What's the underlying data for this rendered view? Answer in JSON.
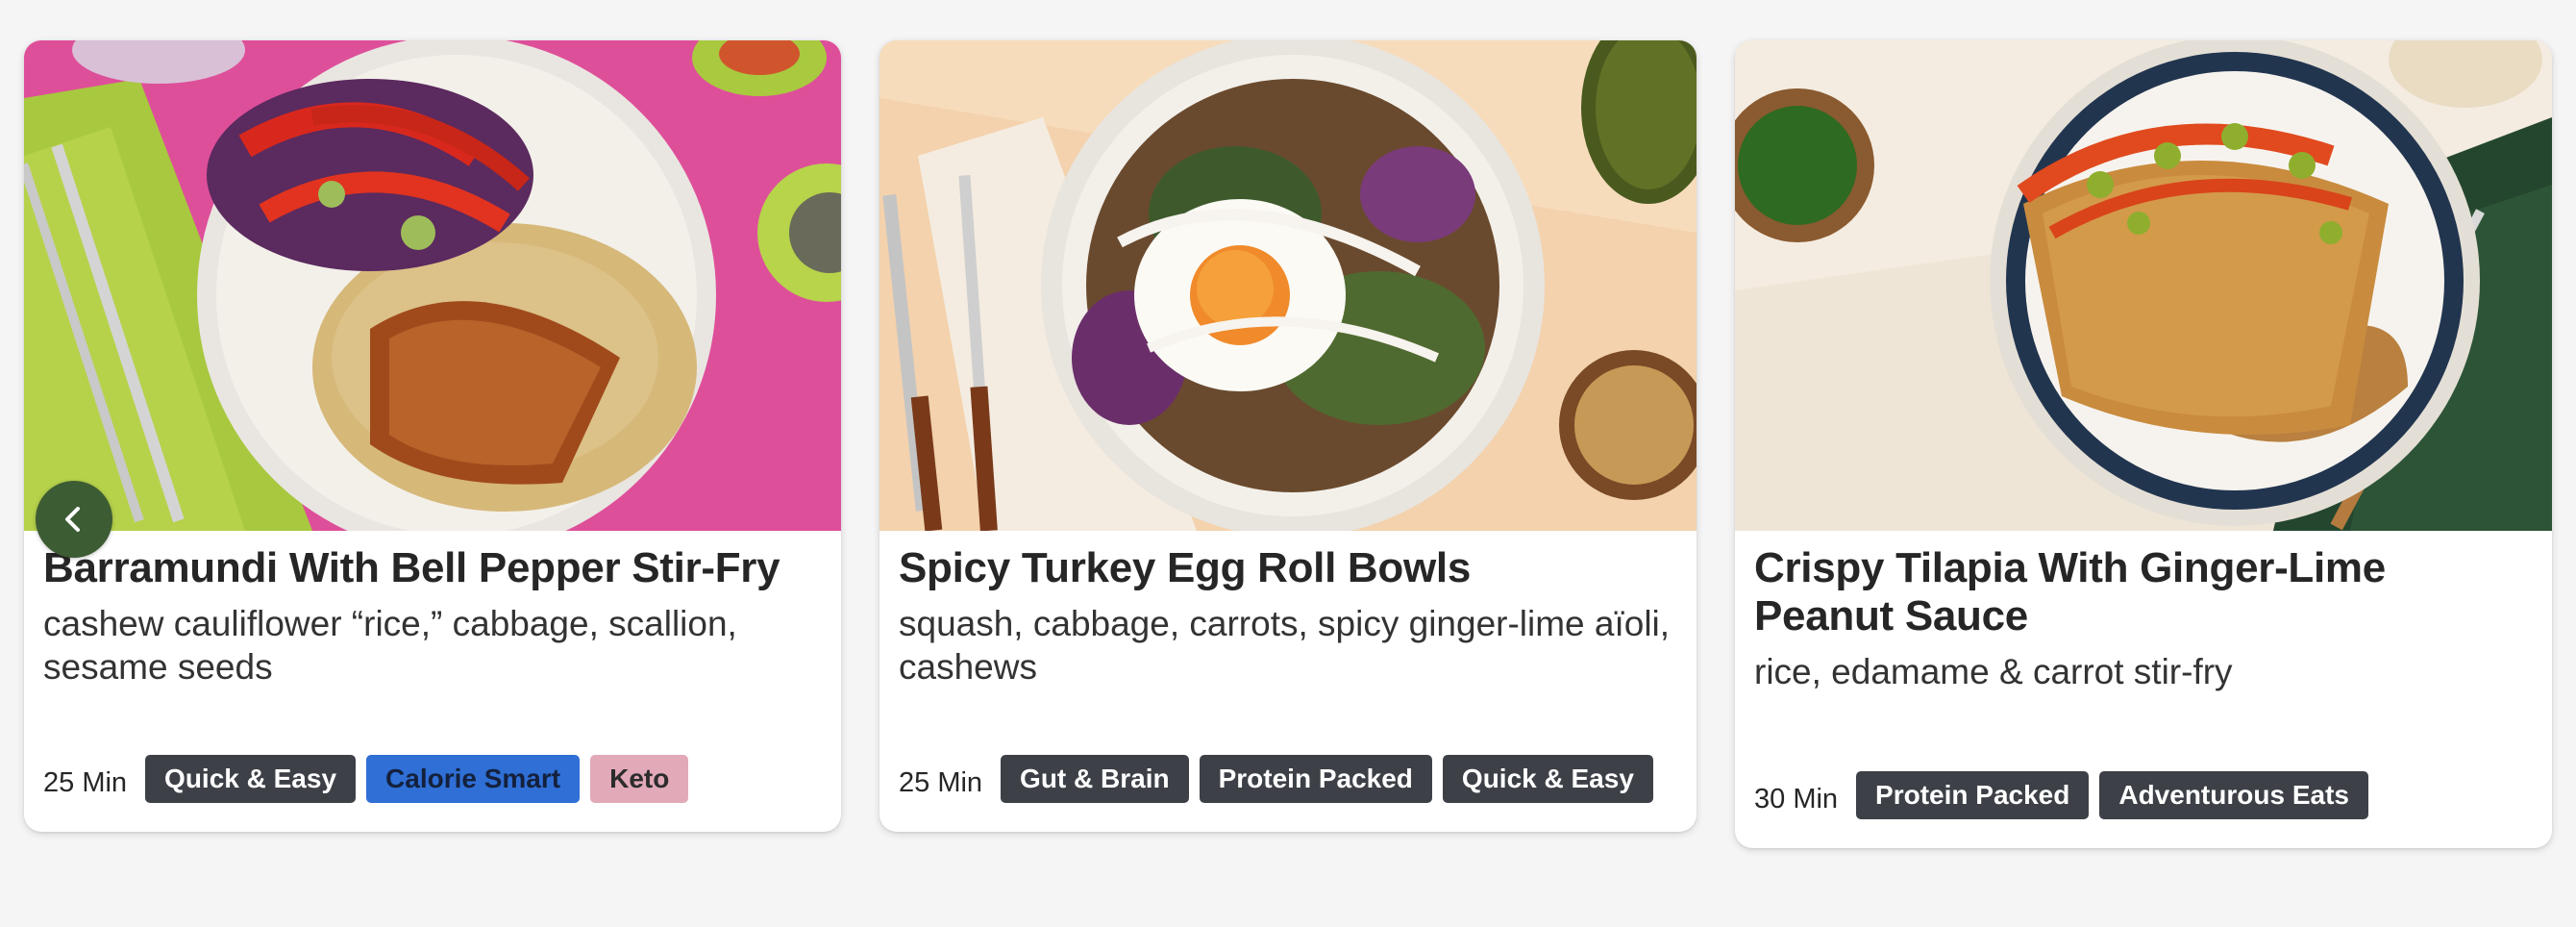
{
  "carousel": {
    "prev_icon": "chevron-left-icon",
    "cards": [
      {
        "image": "barramundi-dish-photo",
        "title": "Barramundi With Bell Pepper Stir-Fry",
        "subtitle": "cashew cauliflower “rice,” cabbage, scallion, sesame seeds",
        "time": "25 Min",
        "tags": [
          {
            "label": "Quick & Easy",
            "color": "#3d4147"
          },
          {
            "label": "Calorie Smart",
            "color": "#2f6fd6"
          },
          {
            "label": "Keto",
            "color": "#e2a9b8"
          }
        ]
      },
      {
        "image": "turkey-egg-roll-bowl-photo",
        "title": "Spicy Turkey Egg Roll Bowls",
        "subtitle": "squash, cabbage, carrots, spicy ginger-lime aïoli, cashews",
        "time": "25 Min",
        "tags": [
          {
            "label": "Gut & Brain",
            "color": "#3d4147"
          },
          {
            "label": "Protein Packed",
            "color": "#3d4147"
          },
          {
            "label": "Quick & Easy",
            "color": "#3d4147"
          }
        ]
      },
      {
        "image": "crispy-tilapia-photo",
        "title": "Crispy Tilapia With Ginger-Lime Peanut Sauce",
        "subtitle": "rice, edamame & carrot stir-fry",
        "time": "30 Min",
        "tags": [
          {
            "label": "Protein Packed",
            "color": "#3d4147"
          },
          {
            "label": "Adventurous Eats",
            "color": "#3d4147"
          }
        ]
      }
    ]
  },
  "colors": {
    "page_background": "#f5f5f5",
    "card_background": "#ffffff",
    "nav_button": "#3c5c33"
  }
}
